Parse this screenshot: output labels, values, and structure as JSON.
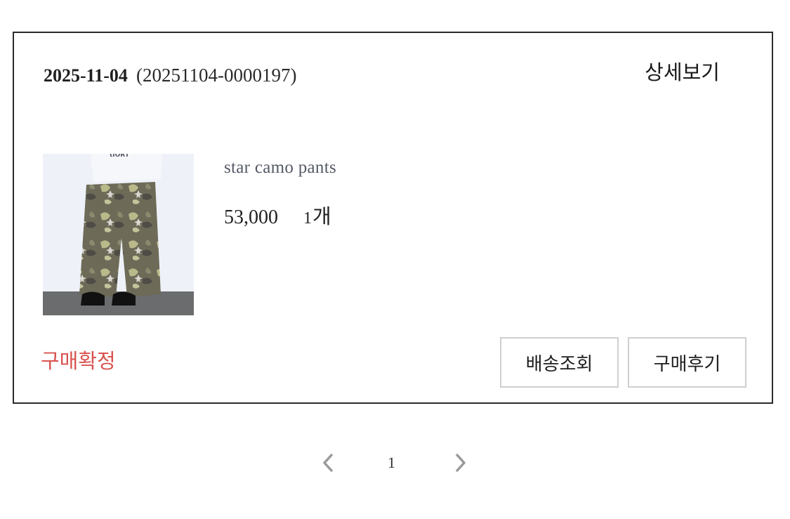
{
  "order": {
    "date": "2025-11-04",
    "order_number": "(20251104-0000197)",
    "detail_label": "상세보기",
    "status": "구매확정",
    "status_color": "#d9534f",
    "item": {
      "name": "star camo pants",
      "price": "53,000",
      "quantity": "1",
      "quantity_unit": "개",
      "image_alt": "camo-pants-photo"
    },
    "buttons": {
      "tracking_label": "배송조회",
      "review_label": "구매후기"
    }
  },
  "pagination": {
    "prev_icon": "chevron-left-icon",
    "current_page": "1",
    "next_icon": "chevron-right-icon"
  }
}
